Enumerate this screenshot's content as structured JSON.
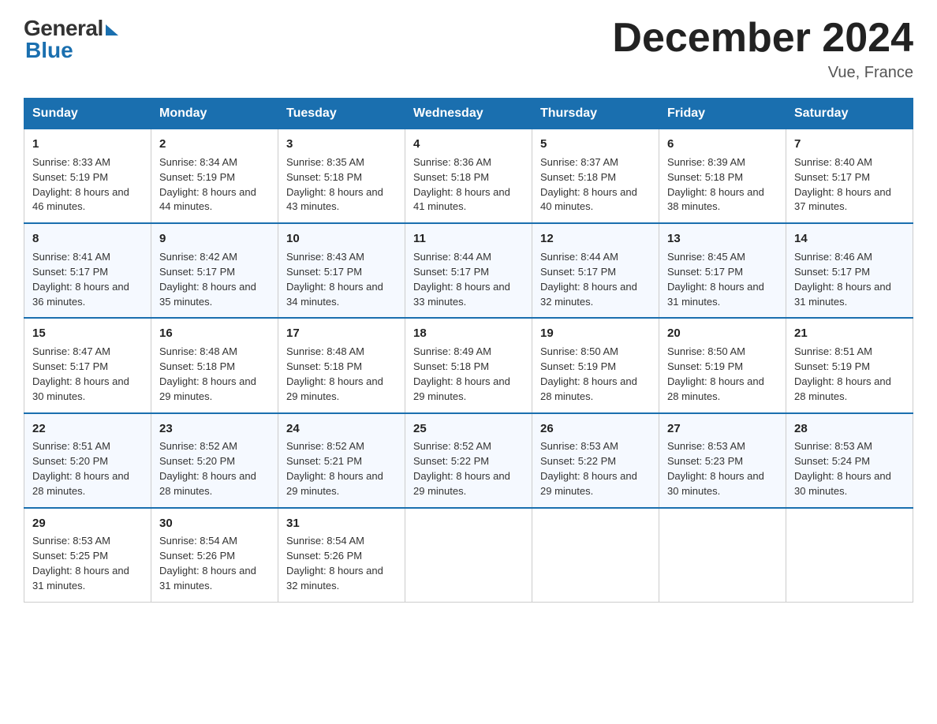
{
  "header": {
    "logo_general": "General",
    "logo_blue": "Blue",
    "month_title": "December 2024",
    "location": "Vue, France"
  },
  "days_of_week": [
    "Sunday",
    "Monday",
    "Tuesday",
    "Wednesday",
    "Thursday",
    "Friday",
    "Saturday"
  ],
  "weeks": [
    [
      {
        "day": "1",
        "sunrise": "8:33 AM",
        "sunset": "5:19 PM",
        "daylight": "8 hours and 46 minutes."
      },
      {
        "day": "2",
        "sunrise": "8:34 AM",
        "sunset": "5:19 PM",
        "daylight": "8 hours and 44 minutes."
      },
      {
        "day": "3",
        "sunrise": "8:35 AM",
        "sunset": "5:18 PM",
        "daylight": "8 hours and 43 minutes."
      },
      {
        "day": "4",
        "sunrise": "8:36 AM",
        "sunset": "5:18 PM",
        "daylight": "8 hours and 41 minutes."
      },
      {
        "day": "5",
        "sunrise": "8:37 AM",
        "sunset": "5:18 PM",
        "daylight": "8 hours and 40 minutes."
      },
      {
        "day": "6",
        "sunrise": "8:39 AM",
        "sunset": "5:18 PM",
        "daylight": "8 hours and 38 minutes."
      },
      {
        "day": "7",
        "sunrise": "8:40 AM",
        "sunset": "5:17 PM",
        "daylight": "8 hours and 37 minutes."
      }
    ],
    [
      {
        "day": "8",
        "sunrise": "8:41 AM",
        "sunset": "5:17 PM",
        "daylight": "8 hours and 36 minutes."
      },
      {
        "day": "9",
        "sunrise": "8:42 AM",
        "sunset": "5:17 PM",
        "daylight": "8 hours and 35 minutes."
      },
      {
        "day": "10",
        "sunrise": "8:43 AM",
        "sunset": "5:17 PM",
        "daylight": "8 hours and 34 minutes."
      },
      {
        "day": "11",
        "sunrise": "8:44 AM",
        "sunset": "5:17 PM",
        "daylight": "8 hours and 33 minutes."
      },
      {
        "day": "12",
        "sunrise": "8:44 AM",
        "sunset": "5:17 PM",
        "daylight": "8 hours and 32 minutes."
      },
      {
        "day": "13",
        "sunrise": "8:45 AM",
        "sunset": "5:17 PM",
        "daylight": "8 hours and 31 minutes."
      },
      {
        "day": "14",
        "sunrise": "8:46 AM",
        "sunset": "5:17 PM",
        "daylight": "8 hours and 31 minutes."
      }
    ],
    [
      {
        "day": "15",
        "sunrise": "8:47 AM",
        "sunset": "5:17 PM",
        "daylight": "8 hours and 30 minutes."
      },
      {
        "day": "16",
        "sunrise": "8:48 AM",
        "sunset": "5:18 PM",
        "daylight": "8 hours and 29 minutes."
      },
      {
        "day": "17",
        "sunrise": "8:48 AM",
        "sunset": "5:18 PM",
        "daylight": "8 hours and 29 minutes."
      },
      {
        "day": "18",
        "sunrise": "8:49 AM",
        "sunset": "5:18 PM",
        "daylight": "8 hours and 29 minutes."
      },
      {
        "day": "19",
        "sunrise": "8:50 AM",
        "sunset": "5:19 PM",
        "daylight": "8 hours and 28 minutes."
      },
      {
        "day": "20",
        "sunrise": "8:50 AM",
        "sunset": "5:19 PM",
        "daylight": "8 hours and 28 minutes."
      },
      {
        "day": "21",
        "sunrise": "8:51 AM",
        "sunset": "5:19 PM",
        "daylight": "8 hours and 28 minutes."
      }
    ],
    [
      {
        "day": "22",
        "sunrise": "8:51 AM",
        "sunset": "5:20 PM",
        "daylight": "8 hours and 28 minutes."
      },
      {
        "day": "23",
        "sunrise": "8:52 AM",
        "sunset": "5:20 PM",
        "daylight": "8 hours and 28 minutes."
      },
      {
        "day": "24",
        "sunrise": "8:52 AM",
        "sunset": "5:21 PM",
        "daylight": "8 hours and 29 minutes."
      },
      {
        "day": "25",
        "sunrise": "8:52 AM",
        "sunset": "5:22 PM",
        "daylight": "8 hours and 29 minutes."
      },
      {
        "day": "26",
        "sunrise": "8:53 AM",
        "sunset": "5:22 PM",
        "daylight": "8 hours and 29 minutes."
      },
      {
        "day": "27",
        "sunrise": "8:53 AM",
        "sunset": "5:23 PM",
        "daylight": "8 hours and 30 minutes."
      },
      {
        "day": "28",
        "sunrise": "8:53 AM",
        "sunset": "5:24 PM",
        "daylight": "8 hours and 30 minutes."
      }
    ],
    [
      {
        "day": "29",
        "sunrise": "8:53 AM",
        "sunset": "5:25 PM",
        "daylight": "8 hours and 31 minutes."
      },
      {
        "day": "30",
        "sunrise": "8:54 AM",
        "sunset": "5:26 PM",
        "daylight": "8 hours and 31 minutes."
      },
      {
        "day": "31",
        "sunrise": "8:54 AM",
        "sunset": "5:26 PM",
        "daylight": "8 hours and 32 minutes."
      },
      null,
      null,
      null,
      null
    ]
  ],
  "labels": {
    "sunrise": "Sunrise:",
    "sunset": "Sunset:",
    "daylight": "Daylight:"
  }
}
